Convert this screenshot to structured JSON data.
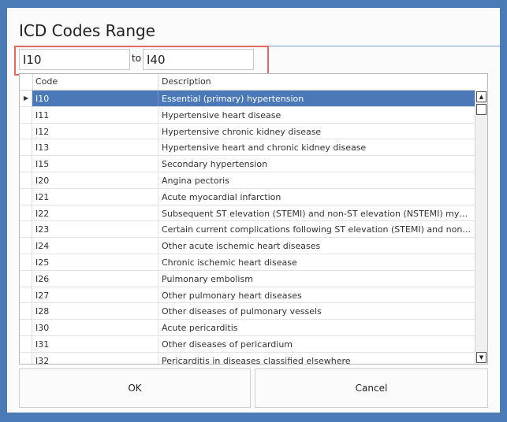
{
  "dialog": {
    "title": "ICD Codes Range",
    "range": {
      "from_value": "I10",
      "to_label": "to",
      "to_value": "I40"
    },
    "grid": {
      "columns": [
        "Code",
        "Description"
      ],
      "rows": [
        {
          "code": "I10",
          "description": "Essential (primary) hypertension"
        },
        {
          "code": "I11",
          "description": "Hypertensive heart disease"
        },
        {
          "code": "I12",
          "description": "Hypertensive chronic kidney disease"
        },
        {
          "code": "I13",
          "description": "Hypertensive heart and chronic kidney disease"
        },
        {
          "code": "I15",
          "description": "Secondary hypertension"
        },
        {
          "code": "I20",
          "description": "Angina pectoris"
        },
        {
          "code": "I21",
          "description": "Acute myocardial infarction"
        },
        {
          "code": "I22",
          "description": "Subsequent ST elevation (STEMI) and non-ST elevation (NSTEMI) myocar..."
        },
        {
          "code": "I23",
          "description": "Certain current complications following ST elevation (STEMI) and non-ST..."
        },
        {
          "code": "I24",
          "description": "Other acute ischemic heart diseases"
        },
        {
          "code": "I25",
          "description": "Chronic ischemic heart disease"
        },
        {
          "code": "I26",
          "description": "Pulmonary embolism"
        },
        {
          "code": "I27",
          "description": "Other pulmonary heart diseases"
        },
        {
          "code": "I28",
          "description": "Other diseases of pulmonary vessels"
        },
        {
          "code": "I30",
          "description": "Acute pericarditis"
        },
        {
          "code": "I31",
          "description": "Other diseases of pericardium"
        },
        {
          "code": "I32",
          "description": "Pericarditis in diseases classified elsewhere"
        }
      ],
      "selected_index": 0
    },
    "buttons": {
      "ok_label": "OK",
      "cancel_label": "Cancel"
    }
  },
  "colors": {
    "background": "#4a7bb7",
    "selection": "#4b78b6",
    "highlight_border": "#e06a60"
  }
}
